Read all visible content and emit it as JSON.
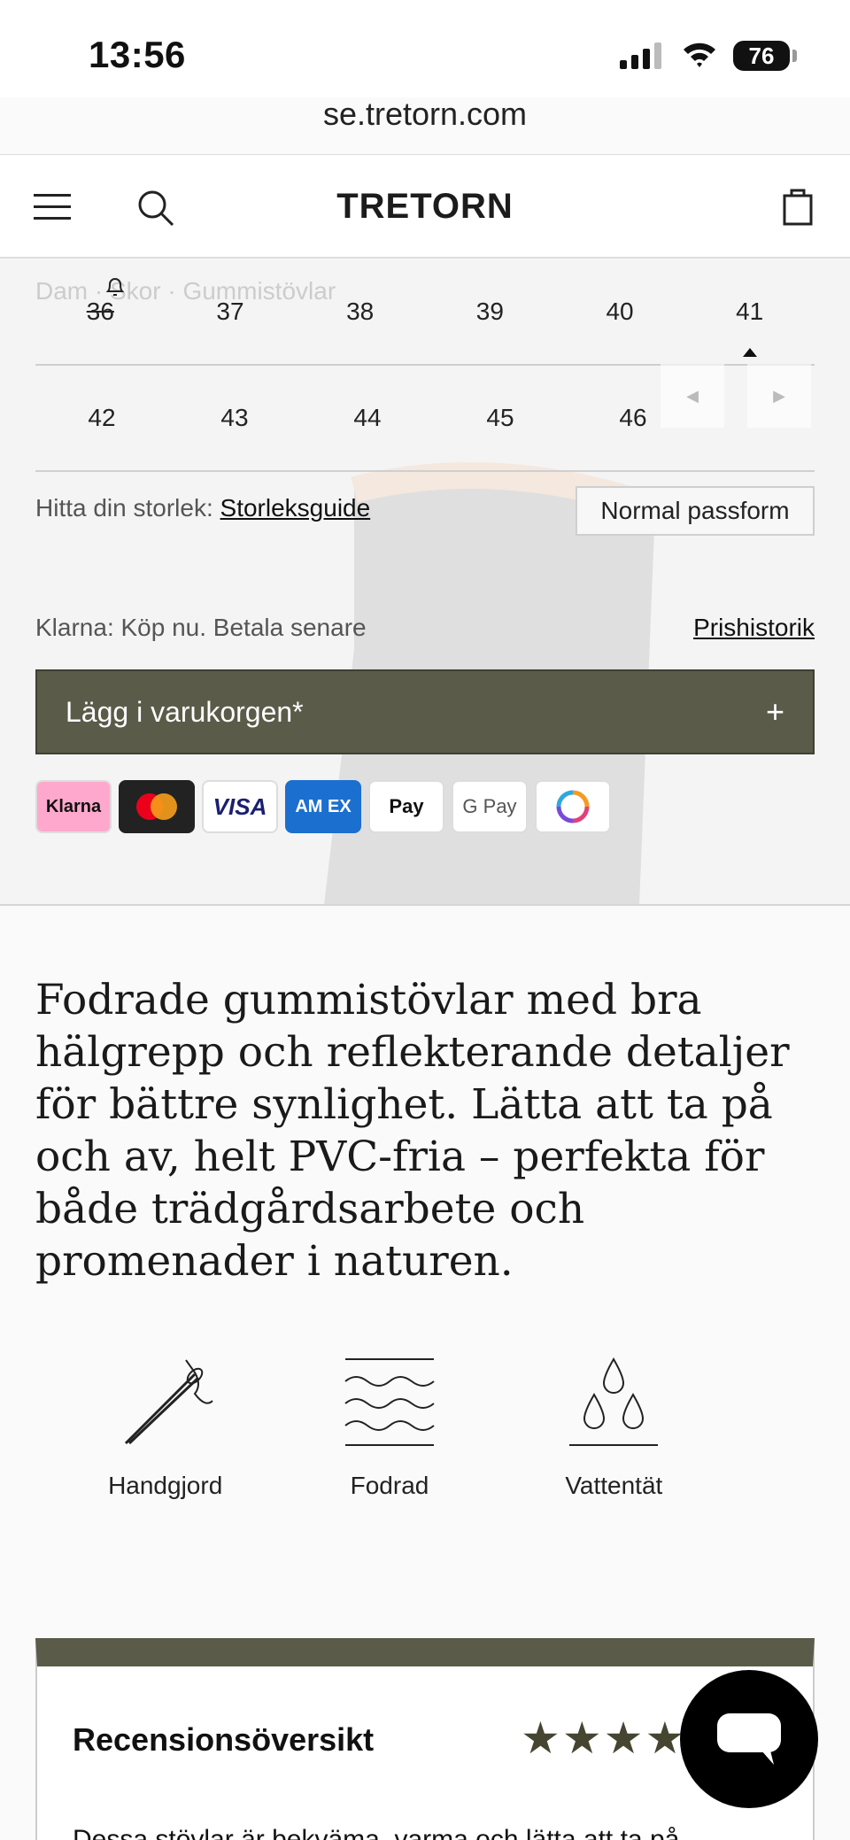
{
  "status_bar": {
    "time": "13:56",
    "battery": "76"
  },
  "browser": {
    "url": "se.tretorn.com"
  },
  "header": {
    "logo": "TRETORN"
  },
  "product": {
    "breadcrumb": "Dam · Skor · Gummistövlar",
    "sizes_row1": [
      "36",
      "37",
      "38",
      "39",
      "40",
      "41"
    ],
    "sizes_row2": [
      "42",
      "43",
      "44",
      "45",
      "46"
    ],
    "sold_out_size": "36",
    "selected_size": "41",
    "size_help_label": "Hitta din storlek:",
    "size_guide_link": "Storleksguide",
    "fit_badge": "Normal passform",
    "klarna_text": "Klarna: Köp nu. Betala senare",
    "price_history_link": "Prishistorik",
    "add_to_cart": "Lägg i varukorgen*",
    "payment_methods": {
      "klarna": "Klarna",
      "visa": "VISA",
      "amex": "AM EX",
      "apple_pay": "Pay",
      "google_pay": "G Pay"
    }
  },
  "description": "Fodrade gummistövlar med bra hälgrepp och reflekterande detaljer för bättre synlighet. Lätta att ta på och av, helt PVC-fria – perfekta för både trädgårdsarbete och promenader i naturen.",
  "features": [
    {
      "label": "Handgjord",
      "icon": "needle-icon"
    },
    {
      "label": "Fodrad",
      "icon": "waves-icon"
    },
    {
      "label": "Vattentät",
      "icon": "water-drops-icon"
    }
  ],
  "reviews": {
    "title": "Recensionsöversikt",
    "stars": "★★★★★",
    "text": "Dessa stövlar är bekväma, varma och lätta att ta på"
  },
  "colors": {
    "accent": "#5b5b4a",
    "klarna": "#ffa8cd",
    "amex": "#1b6fcf"
  }
}
